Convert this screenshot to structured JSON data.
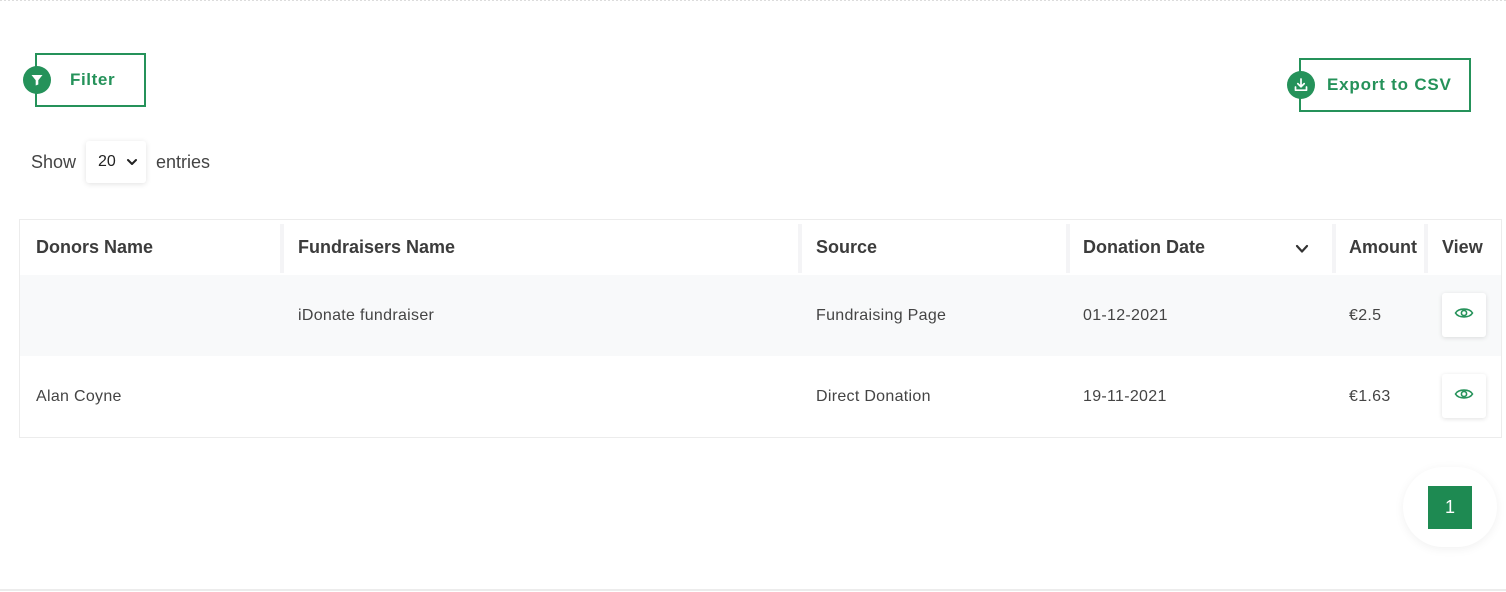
{
  "toolbar": {
    "filter_label": "Filter",
    "filter_icon": "filter-funnel-icon",
    "export_label": "Export to CSV",
    "export_icon": "download-icon"
  },
  "entries": {
    "show_label": "Show",
    "selected": "20",
    "suffix_label": "entries"
  },
  "table": {
    "columns": [
      "Donors Name",
      "Fundraisers Name",
      "Source",
      "Donation Date",
      "Amount",
      "View"
    ],
    "sorted_column": "Donation Date",
    "rows": [
      {
        "donor": "",
        "fundraiser": "iDonate fundraiser",
        "source": "Fundraising Page",
        "date": "01-12-2021",
        "amount": "€2.5",
        "view_icon": "eye-icon"
      },
      {
        "donor": "Alan Coyne",
        "fundraiser": "",
        "source": "Direct Donation",
        "date": "19-11-2021",
        "amount": "€1.63",
        "view_icon": "eye-icon"
      }
    ]
  },
  "pagination": {
    "current_page": "1"
  },
  "colors": {
    "accent": "#25925a",
    "page_active": "#1e8a52",
    "row_alt": "#f8f9fa"
  }
}
